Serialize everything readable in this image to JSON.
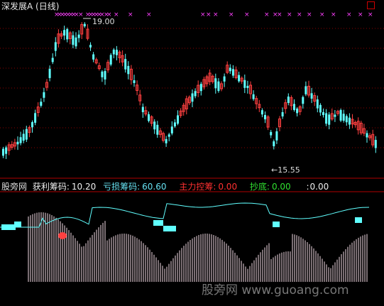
{
  "header": {
    "title": "深发展A",
    "period": "(日线)"
  },
  "price_panel": {
    "high_marker": "19.00",
    "low_marker": "←15.55"
  },
  "indicator_panel": {
    "name": "股旁网",
    "items": [
      {
        "label": "获利筹码:",
        "value": "10.20",
        "color": "#f0f0f0"
      },
      {
        "label": "亏损筹码:",
        "value": "60.60",
        "color": "#66e0f0"
      },
      {
        "label": "主力控筹:",
        "value": "0.00",
        "color": "#ff3030"
      },
      {
        "label": "抄底:",
        "value": "0.00",
        "color": "#30e030"
      },
      {
        "label": ":",
        "value": "0.00",
        "color": "#f0f0f0"
      }
    ]
  },
  "watermark": "股旁网 www.guoang.com",
  "colors": {
    "bull": "#ff4040",
    "bear": "#60ffff",
    "signal": "#ff40ff",
    "grid": "#8b0000",
    "panel_border": "#b00000"
  }
}
